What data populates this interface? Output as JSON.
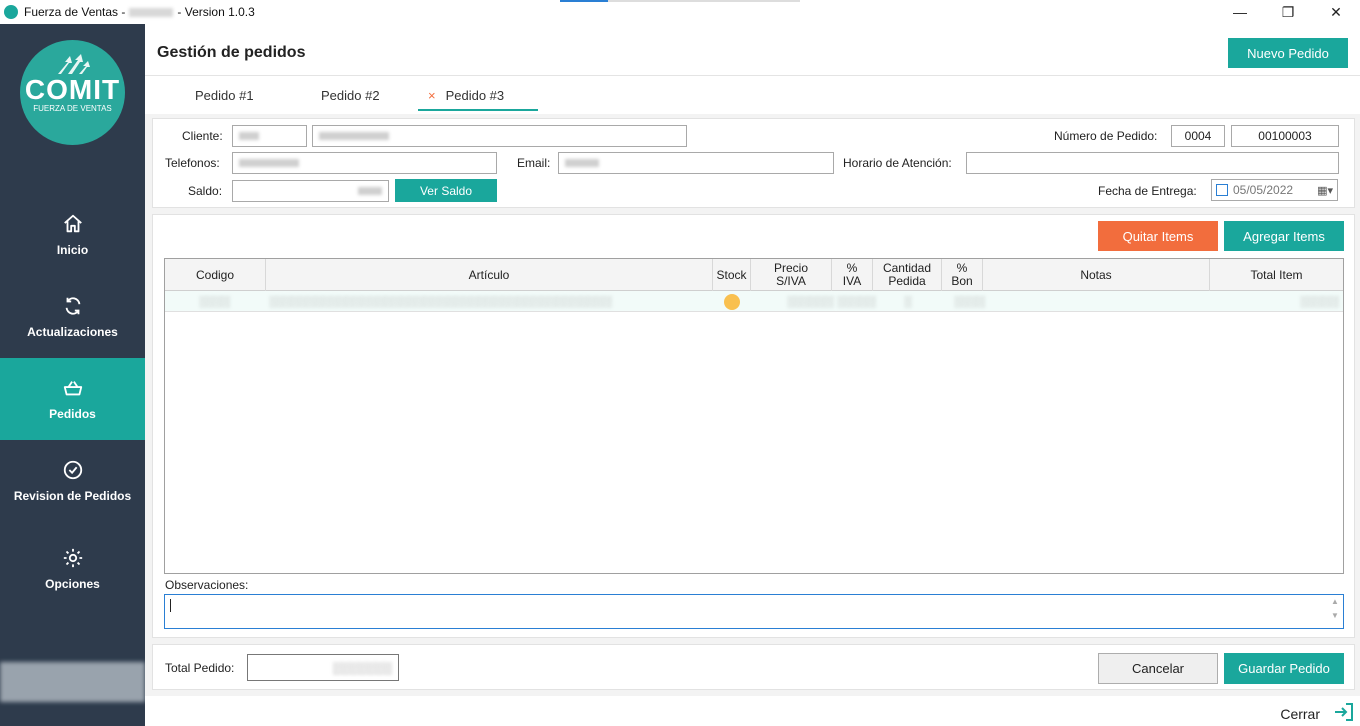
{
  "window": {
    "title_prefix": "Fuerza de Ventas -",
    "title_suffix": "- Version 1.0.3",
    "minimize": "—",
    "maximize": "❐",
    "close": "✕"
  },
  "brand": {
    "logo_text": "COMIT",
    "logo_sub": "FUERZA DE VENTAS",
    "accent": "#1aa79c",
    "sidebar_bg": "#2e3b4c",
    "orange": "#f26d3d"
  },
  "sidebar": {
    "items": [
      {
        "label": "Inicio",
        "icon": "home-icon"
      },
      {
        "label": "Actualizaciones",
        "icon": "refresh-icon"
      },
      {
        "label": "Pedidos",
        "icon": "basket-icon"
      },
      {
        "label": "Revision de Pedidos",
        "icon": "check-circle-icon"
      },
      {
        "label": "Opciones",
        "icon": "gear-icon"
      }
    ]
  },
  "header": {
    "title": "Gestión de pedidos",
    "new_button": "Nuevo Pedido"
  },
  "tabs": [
    {
      "label": "Pedido #1"
    },
    {
      "label": "Pedido #2"
    },
    {
      "label": "Pedido #3",
      "close": "×"
    }
  ],
  "form": {
    "cliente_label": "Cliente:",
    "telefonos_label": "Telefonos:",
    "email_label": "Email:",
    "horario_label": "Horario de Atención:",
    "saldo_label": "Saldo:",
    "ver_saldo": "Ver Saldo",
    "numero_label": "Número de Pedido:",
    "numero_serie": "0004",
    "numero": "00100003",
    "fecha_label": "Fecha de Entrega:",
    "fecha": "05/05/2022"
  },
  "actions": {
    "quitar": "Quitar Items",
    "agregar": "Agregar Items"
  },
  "grid": {
    "columns": [
      {
        "label": "Codigo"
      },
      {
        "label": "Artículo"
      },
      {
        "label": "Stock"
      },
      {
        "label": "Precio S/IVA"
      },
      {
        "label": "% IVA"
      },
      {
        "label": "Cantidad Pedida"
      },
      {
        "label": "% Bon"
      },
      {
        "label": "Notas"
      },
      {
        "label": "Total Item"
      }
    ]
  },
  "observaciones_label": "Observaciones:",
  "footer": {
    "total_label": "Total Pedido:",
    "cancelar": "Cancelar",
    "guardar": "Guardar Pedido",
    "cerrar": "Cerrar"
  }
}
